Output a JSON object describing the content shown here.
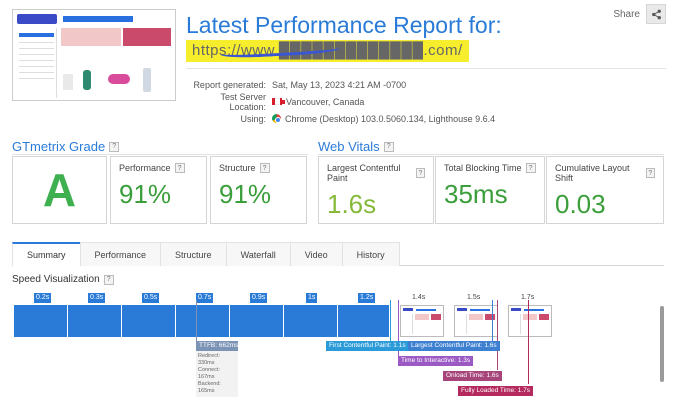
{
  "report": {
    "title": "Latest Performance Report for:",
    "url": "https://www.█████████████.com/",
    "share_label": "Share",
    "meta": [
      {
        "key": "Report generated:",
        "value": "Sat, May 13, 2023 4:21 AM -0700",
        "icon": ""
      },
      {
        "key": "Test Server Location:",
        "value": "Vancouver, Canada",
        "icon": "canada-flag-icon"
      },
      {
        "key": "Using:",
        "value": "Chrome (Desktop) 103.0.5060.134, Lighthouse 9.6.4",
        "icon": "chrome-icon"
      }
    ]
  },
  "grade": {
    "section_title": "GTmetrix Grade",
    "letter": "A",
    "performance_label": "Performance",
    "performance_value": "91%",
    "structure_label": "Structure",
    "structure_value": "91%"
  },
  "vitals": {
    "section_title": "Web Vitals",
    "lcp_label": "Largest Contentful Paint",
    "lcp_value": "1.6s",
    "tbt_label": "Total Blocking Time",
    "tbt_value": "35ms",
    "cls_label": "Cumulative Layout Shift",
    "cls_value": "0.03"
  },
  "tabs": [
    "Summary",
    "Performance",
    "Structure",
    "Waterfall",
    "Video",
    "History"
  ],
  "speed": {
    "title": "Speed Visualization",
    "frames": [
      "0.2s",
      "0.3s",
      "0.5s",
      "0.7s",
      "0.9s",
      "1s",
      "1.2s",
      "1.4s",
      "1.5s",
      "1.7s"
    ],
    "ttfb": {
      "label": "TTFB: 662ms",
      "redirect": "Redirect: 330ms",
      "connect": "Connect: 167ms",
      "backend": "Backend: 165ms"
    },
    "events": {
      "fcp": "First Contentful Paint: 1.1s",
      "lcp": "Largest Contentful Paint: 1.6s",
      "tti": "Time to Interactive: 1.3s",
      "onload": "Onload Time: 1.6s",
      "fully_loaded": "Fully Loaded Time: 1.7s"
    }
  },
  "colors": {
    "accent": "#2a7bd8",
    "grade": "#3fb04f",
    "good_value": "#3a9e3a",
    "fcp": "#2a9bd8",
    "lcp": "#3d7fd0",
    "tti": "#9b59c4",
    "onload": "#a6457a",
    "fully_loaded": "#b42a5e"
  }
}
